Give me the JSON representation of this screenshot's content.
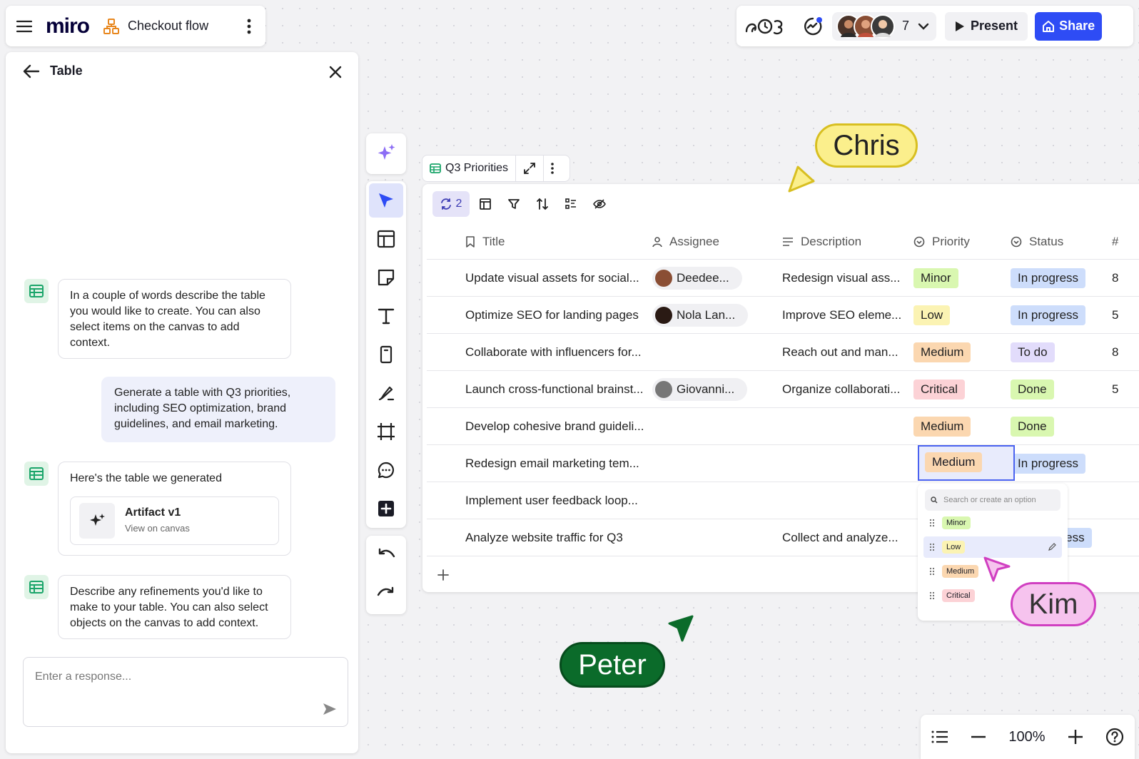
{
  "header": {
    "logo": "miro",
    "board_name": "Checkout flow",
    "collaborator_count": "7",
    "present_label": "Present",
    "share_label": "Share"
  },
  "panel": {
    "title": "Table",
    "messages": [
      {
        "role": "ai",
        "text": "In a couple of words describe the table you would like to create. You can also select items on the canvas to add context."
      },
      {
        "role": "user",
        "text": "Generate a table with Q3 priorities, including SEO optimization, brand guidelines, and email marketing."
      },
      {
        "role": "ai",
        "text": "Here's the table we generated",
        "artifact": {
          "title": "Artifact v1",
          "subtitle": "View on canvas"
        }
      },
      {
        "role": "ai",
        "text": "Describe any refinements you'd like to make to your table. You can also select objects on the canvas to add context."
      }
    ],
    "input_placeholder": "Enter a response..."
  },
  "table": {
    "name": "Q3 Priorities",
    "sync_count": "2",
    "columns": [
      "Title",
      "Assignee",
      "Description",
      "Priority",
      "Status",
      "#"
    ],
    "rows": [
      {
        "title": "Update visual assets for social...",
        "assignee": "Deedee...",
        "description": "Redesign visual ass...",
        "priority": "Minor",
        "status": "In progress",
        "num": "8"
      },
      {
        "title": "Optimize SEO for landing pages",
        "assignee": "Nola Lan...",
        "description": "Improve SEO eleme...",
        "priority": "Low",
        "status": "In progress",
        "num": "5"
      },
      {
        "title": "Collaborate with influencers for...",
        "assignee": "",
        "description": "Reach out and man...",
        "priority": "Medium",
        "status": "To do",
        "num": "8"
      },
      {
        "title": "Launch cross-functional brainst...",
        "assignee": "Giovanni...",
        "description": "Organize collaborati...",
        "priority": "Critical",
        "status": "Done",
        "num": "5"
      },
      {
        "title": "Develop cohesive brand guideli...",
        "assignee": "",
        "description": "",
        "priority": "Medium",
        "status": "Done",
        "num": ""
      },
      {
        "title": "Redesign email marketing tem...",
        "assignee": "",
        "description": "",
        "priority": "Medium",
        "status": "In progress",
        "num": ""
      },
      {
        "title": "Implement user feedback loop...",
        "assignee": "",
        "description": "",
        "priority": "",
        "status": "",
        "num": ""
      },
      {
        "title": "Analyze website traffic for Q3",
        "assignee": "",
        "description": "Collect and analyze...",
        "priority": "",
        "status": "gress",
        "num": ""
      }
    ]
  },
  "dropdown": {
    "search_placeholder": "Search or create an option",
    "options": [
      "Minor",
      "Low",
      "Medium",
      "Critical"
    ]
  },
  "cursors": [
    "Chris",
    "Kim",
    "Peter"
  ],
  "zoom": "100%",
  "colors": {
    "accent": "#2e4cf5",
    "minor": "#d9f7b0",
    "low": "#fbf3b3",
    "medium": "#fbd7b0",
    "critical": "#fcd2d6",
    "in_progress": "#cdddfb",
    "to_do": "#e2dcfb",
    "done": "#d9f7b0",
    "chris": "#fbef8c",
    "kim": "#f6c3ee",
    "peter": "#0b6b2a"
  }
}
